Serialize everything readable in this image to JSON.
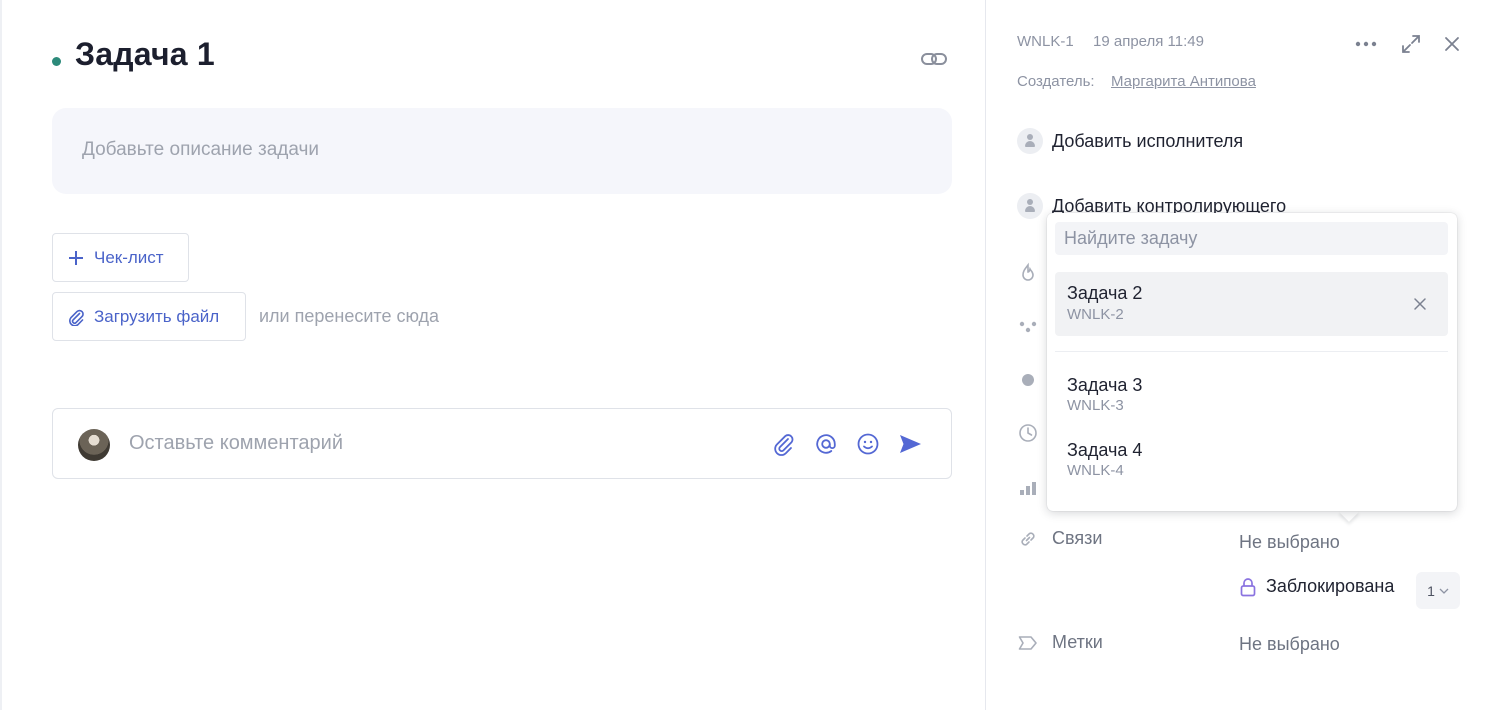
{
  "task": {
    "title": "Задача 1",
    "description_placeholder": "Добавьте описание задачи",
    "checklist_label": "Чек-лист",
    "upload_label": "Загрузить файл",
    "drop_hint": "или перенесите сюда",
    "comment_placeholder": "Оставьте комментарий",
    "status_dot_color": "#2c8a7a"
  },
  "header": {
    "task_id": "WNLK-1",
    "date": "19 апреля 11:49",
    "creator_label": "Создатель:",
    "creator_name": "Маргарита Антипова",
    "icons": [
      "more-icon",
      "expand-icon",
      "close-icon"
    ]
  },
  "people": {
    "assignee_label": "Добавить исполнителя",
    "controller_label": "Добавить контролирующего"
  },
  "properties": {
    "links_label": "Связи",
    "links_value": "Не выбрано",
    "blocked_label": "Заблокирована",
    "blocked_count": "1",
    "tags_label": "Метки",
    "tags_value": "Не выбрано"
  },
  "popup": {
    "search_placeholder": "Найдите задачу",
    "selected": {
      "name": "Задача 2",
      "id": "WNLK-2"
    },
    "options": [
      {
        "name": "Задача 3",
        "id": "WNLK-3"
      },
      {
        "name": "Задача 4",
        "id": "WNLK-4"
      }
    ]
  },
  "colors": {
    "accent": "#4a63c9",
    "send_icon": "#5468d4",
    "lock_icon": "#8a73e0"
  }
}
